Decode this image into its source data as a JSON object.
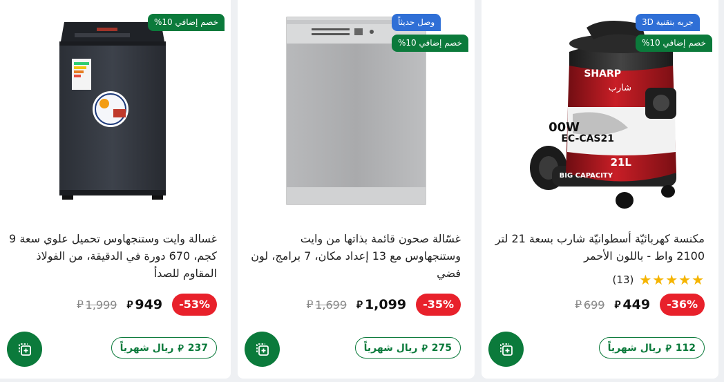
{
  "currency_symbol": "⃁",
  "products": [
    {
      "badges": [
        {
          "text": "جربه بتقنية 3D",
          "color": "#2f6fd6"
        },
        {
          "text": "خصم إضافي 10%",
          "color": "#0b7a3b"
        }
      ],
      "title": "مكنسة كهربائيّة أسطوانيّة شارب بسعة 21 لتر 2100 واط - باللون الأحمر",
      "rating": {
        "stars": "★★★★★",
        "count": "(13)"
      },
      "discount": "-36%",
      "price": "449",
      "old_price": "699",
      "monthly_amount": "112",
      "monthly_label": "ريال شهرياً",
      "image_text": {
        "brand": "SHARP",
        "brand_ar": "شارب",
        "model": "EC-CAS21",
        "capacity": "21L",
        "cap_label": "BIG CAPACITY",
        "power": "00W"
      }
    },
    {
      "badges": [
        {
          "text": "وصل حديثاً",
          "color": "#2f6fd6"
        },
        {
          "text": "خصم إضافي 10%",
          "color": "#0b7a3b"
        }
      ],
      "title": "غسّالة صحون قائمة بذاتها من وايت وستنجهاوس مع 13 إعداد مكان، 7 برامج، لون فضي",
      "discount": "-35%",
      "price": "1,099",
      "old_price": "1,699",
      "monthly_amount": "275",
      "monthly_label": "ريال شهرياً"
    },
    {
      "badges": [
        {
          "text": "خصم إضافي 10%",
          "color": "#0b7a3b"
        }
      ],
      "title": "غسالة وايت وستنجهاوس تحميل علوي سعة 9 كجم، 670 دورة في الدقيقة، من الفولاذ المقاوم للصدأ",
      "discount": "-53%",
      "price": "949",
      "old_price": "1,999",
      "monthly_amount": "237",
      "monthly_label": "ريال شهرياً"
    }
  ]
}
